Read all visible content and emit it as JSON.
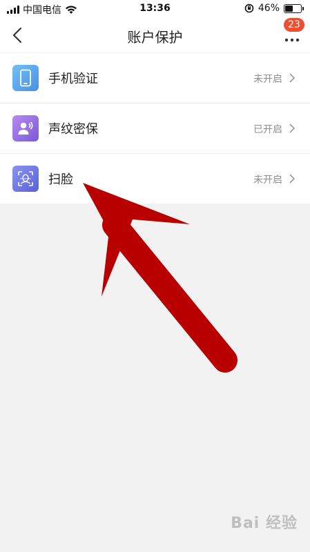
{
  "status_bar": {
    "carrier": "中国电信",
    "time": "13:36",
    "battery": "46%"
  },
  "nav": {
    "title": "账户保护",
    "badge_count": "23"
  },
  "items": [
    {
      "label": "手机验证",
      "status": "未开启",
      "icon": "phone-icon"
    },
    {
      "label": "声纹密保",
      "status": "已开启",
      "icon": "voiceprint-icon"
    },
    {
      "label": "扫脸",
      "status": "未开启",
      "icon": "face-scan-icon"
    }
  ],
  "colors": {
    "badge": "#ec4f30",
    "arrow": "#b90000",
    "status_text": "#8e8e8e"
  },
  "watermark": "Bai 经验"
}
